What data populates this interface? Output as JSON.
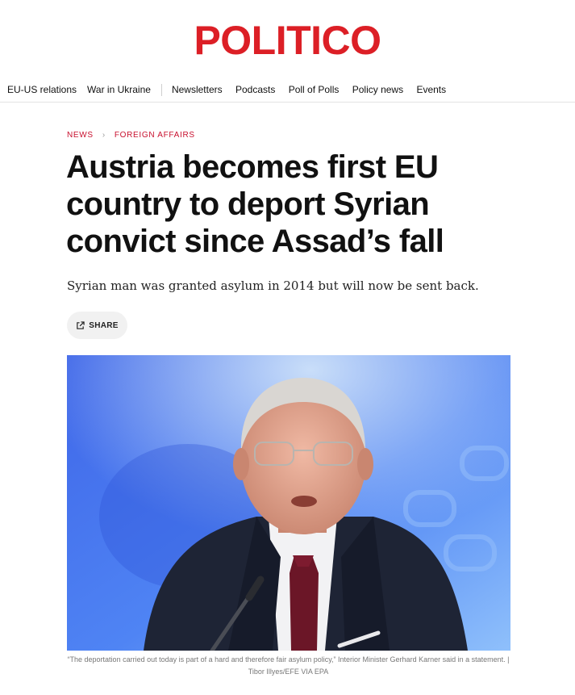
{
  "brand": {
    "logo_text": "POLITICO",
    "color": "#dc1f26"
  },
  "nav": {
    "primary": [
      "EU-US relations",
      "War in Ukraine"
    ],
    "secondary": [
      "Newsletters",
      "Podcasts",
      "Poll of Polls",
      "Policy news",
      "Events"
    ]
  },
  "breadcrumb": {
    "section": "NEWS",
    "subsection": "FOREIGN AFFAIRS",
    "separator": "›"
  },
  "article": {
    "headline": "Austria becomes first EU country to deport Syrian convict since Assad’s fall",
    "dek": "Syrian man was granted asylum in 2014 but will now be sent back.",
    "share_label": "SHARE",
    "share_icon": "share-external-icon"
  },
  "image": {
    "subject": "Man in dark suit and red tie speaking at a microphone in front of a blue backdrop",
    "caption": "“The deportation carried out today is part of a hard and therefore fair asylum policy,” Interior Minister Gerhard Karner said in a statement. | Tibor Illyes/EFE VIA EPA"
  },
  "colors": {
    "accent": "#c8102e",
    "text": "#111111"
  }
}
